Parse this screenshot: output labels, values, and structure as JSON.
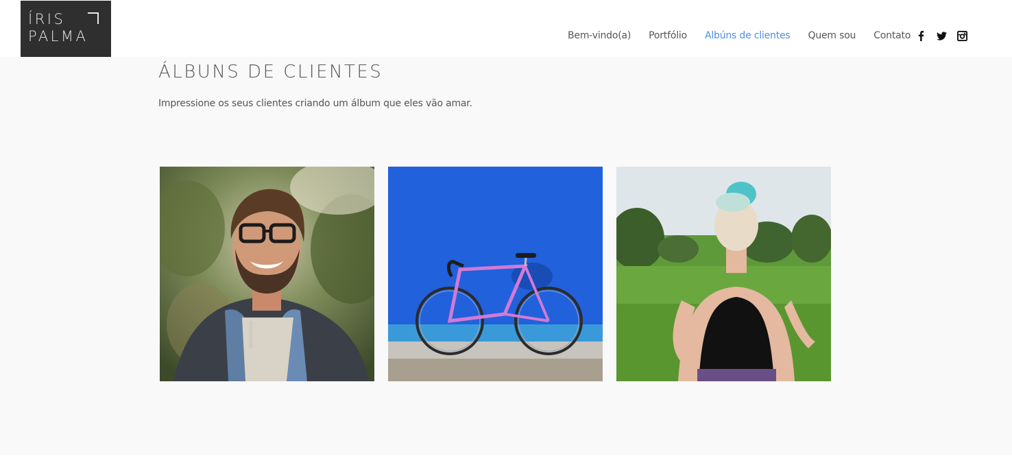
{
  "brand": {
    "line1": "ÍRIS",
    "line2": "PALMA"
  },
  "nav": {
    "items": [
      {
        "label": "Bem-vindo(a)",
        "active": false
      },
      {
        "label": "Portfólio",
        "active": false
      },
      {
        "label": "Albúns de clientes",
        "active": true
      },
      {
        "label": "Quem sou",
        "active": false
      },
      {
        "label": "Contato",
        "active": false
      }
    ],
    "active_color": "#4a8fe0",
    "social": [
      "facebook-icon",
      "twitter-icon",
      "instagram-icon"
    ]
  },
  "page": {
    "title": "ÁLBUNS DE CLIENTES",
    "subtitle": "Impressione os seus clientes criando um álbum que eles vão amar."
  },
  "albums": [
    {
      "image": "smiling-man-with-glasses-photo"
    },
    {
      "image": "pink-bicycle-blue-wall-photo"
    },
    {
      "image": "woman-blue-hair-field-photo"
    }
  ]
}
